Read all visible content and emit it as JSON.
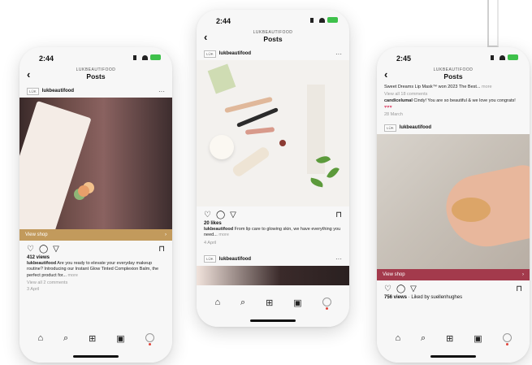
{
  "colors": {
    "left_shop_bar": "#c29a5c",
    "right_shop_bar": "#a33a4c",
    "battery": "#3ec14b"
  },
  "nav": {
    "subtitle": "LUKBEAUTIFOOD",
    "title": "Posts"
  },
  "left": {
    "time": "2:44",
    "username": "lukbeautifood",
    "logo": "LÜK",
    "view_shop": "View shop",
    "views": "412 views",
    "caption_user": "lukbeautifood",
    "caption": "Are you ready to elevate your everyday makeup routine? Introducing our Instant Glow Tinted Complexion Balm, the perfect product for...",
    "caption_more": "more",
    "comments": "View all 2 comments",
    "date": "3 April"
  },
  "center": {
    "time": "2:44",
    "username": "lukbeautifood",
    "logo": "LÜK",
    "likes": "20 likes",
    "caption_user": "lukbeautifood",
    "caption": "From lip care to glowing skin, we have everything you need...",
    "caption_more": "more",
    "date": "4 April",
    "next_username": "lukbeautifood",
    "next_logo": "LÜK"
  },
  "right": {
    "time": "2:45",
    "prev_caption": "Sweet Dreams Lip Mask™ won 2023 The Best...",
    "prev_more": "more",
    "prev_comments": "View all 18 comments",
    "comment_user": "candicelumal",
    "comment_text": "Cindy! You are so beautiful & we love you congrats!",
    "comment_date": "28 March",
    "username": "lukbeautifood",
    "logo": "LÜK",
    "view_shop": "View shop",
    "views": "756 views",
    "liked_by": "· Liked by suellenhughes"
  }
}
